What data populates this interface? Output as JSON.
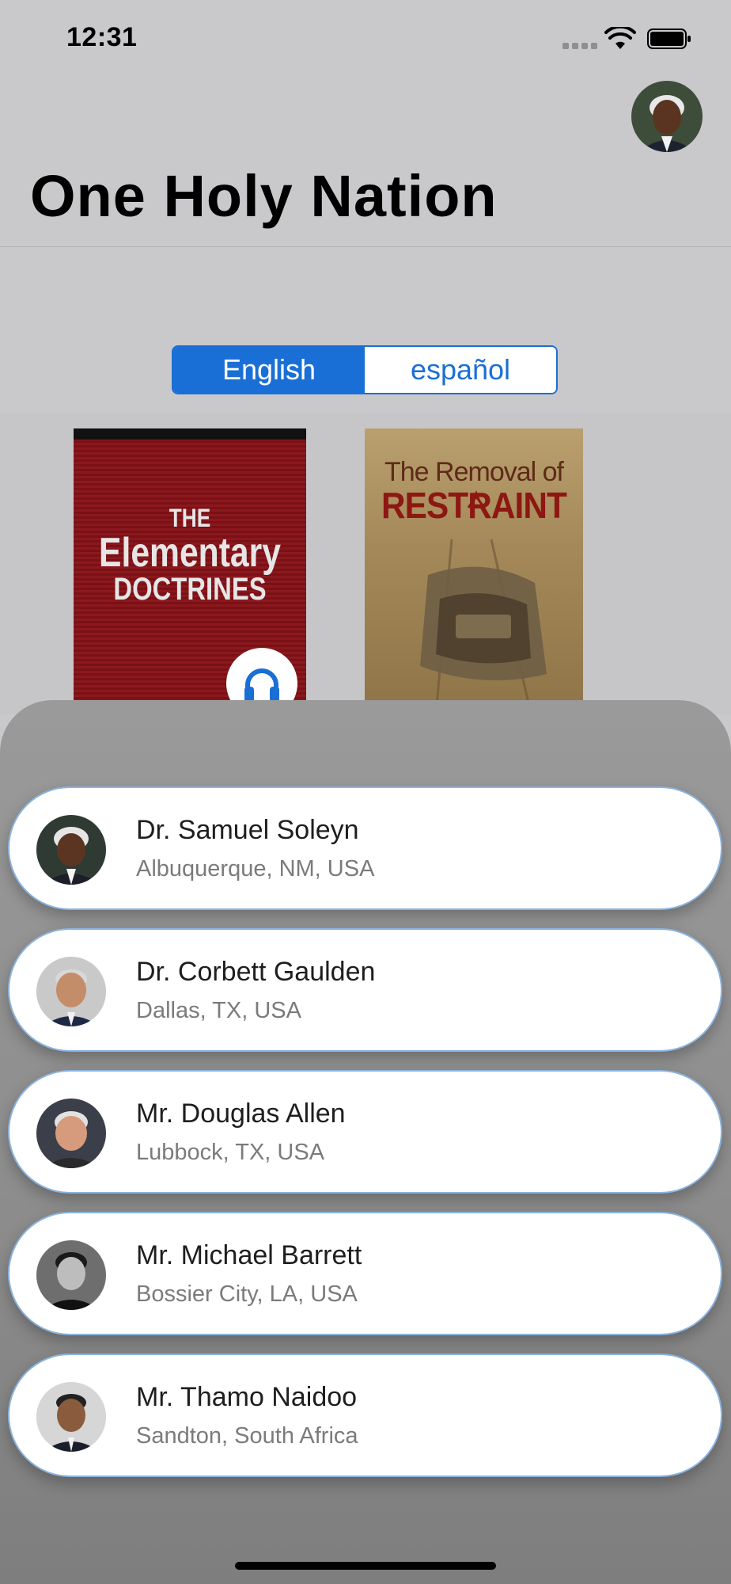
{
  "status_bar": {
    "time": "12:31"
  },
  "header": {
    "title": "One Holy Nation"
  },
  "language_selector": {
    "options": [
      "English",
      "español"
    ],
    "selected": "English"
  },
  "books": [
    {
      "title_lines": [
        "THE",
        "Elementary",
        "DOCTRINES"
      ],
      "has_audio": true
    },
    {
      "title_lines": [
        "The Removal of",
        "RESTRAINT"
      ]
    }
  ],
  "speakers": [
    {
      "name": "Dr. Samuel Soleyn",
      "location": "Albuquerque, NM, USA"
    },
    {
      "name": "Dr. Corbett Gaulden",
      "location": "Dallas, TX, USA"
    },
    {
      "name": "Mr. Douglas Allen",
      "location": "Lubbock, TX, USA"
    },
    {
      "name": "Mr. Michael Barrett",
      "location": "Bossier City, LA, USA"
    },
    {
      "name": "Mr. Thamo Naidoo",
      "location": "Sandton, South Africa"
    }
  ],
  "colors": {
    "accent": "#1a6fd6",
    "card_border": "#8ab4e0"
  }
}
